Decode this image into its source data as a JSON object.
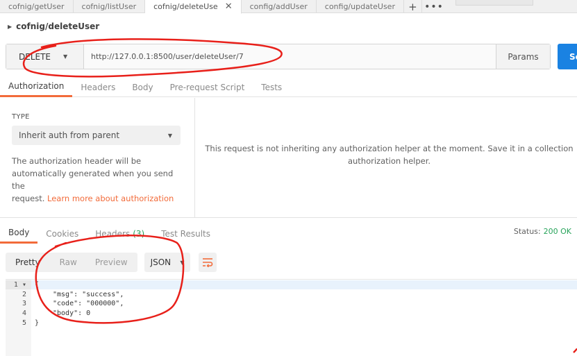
{
  "tabs": [
    {
      "label": "cofnig/getUser",
      "active": false
    },
    {
      "label": "cofnig/listUser",
      "active": false
    },
    {
      "label": "cofnig/deleteUse",
      "active": true
    },
    {
      "label": "config/addUser",
      "active": false
    },
    {
      "label": "config/updateUser",
      "active": false
    }
  ],
  "tab_add": "+",
  "tab_more": "•••",
  "tab_close": "✕",
  "request": {
    "name": "cofnig/deleteUser",
    "method": "DELETE",
    "url": "http://127.0.0.1:8500/user/deleteUser/7",
    "params_label": "Params",
    "send_label": "Se"
  },
  "request_tabs": [
    "Authorization",
    "Headers",
    "Body",
    "Pre-request Script",
    "Tests"
  ],
  "auth": {
    "type_label": "TYPE",
    "type_value": "Inherit auth from parent",
    "desc_1": "The authorization header will be",
    "desc_2": "automatically generated when you send the",
    "desc_3": "request.",
    "desc_link": "Learn more about authorization",
    "message_1": "This request is not inheriting any authorization helper at the moment. Save it in a collection",
    "message_2": "authorization helper."
  },
  "response": {
    "tabs": [
      {
        "label": "Body",
        "active": true,
        "count": ""
      },
      {
        "label": "Cookies",
        "active": false,
        "count": ""
      },
      {
        "label": "Headers",
        "active": false,
        "count": "(3)"
      },
      {
        "label": "Test Results",
        "active": false,
        "count": ""
      }
    ],
    "status_label": "Status:",
    "status_value": "200 OK",
    "view_modes": [
      "Pretty",
      "Raw",
      "Preview"
    ],
    "format": "JSON",
    "line_numbers": [
      "1",
      "2",
      "3",
      "4",
      "5"
    ],
    "code_lines": [
      "{",
      "\"msg\": \"success\",",
      "\"code\": \"000000\",",
      "\"body\": 0",
      "}"
    ]
  },
  "colors": {
    "accent": "#f26b3a",
    "send": "#1a82e2",
    "status_ok": "#27a35a",
    "annotation": "#e8201a"
  }
}
